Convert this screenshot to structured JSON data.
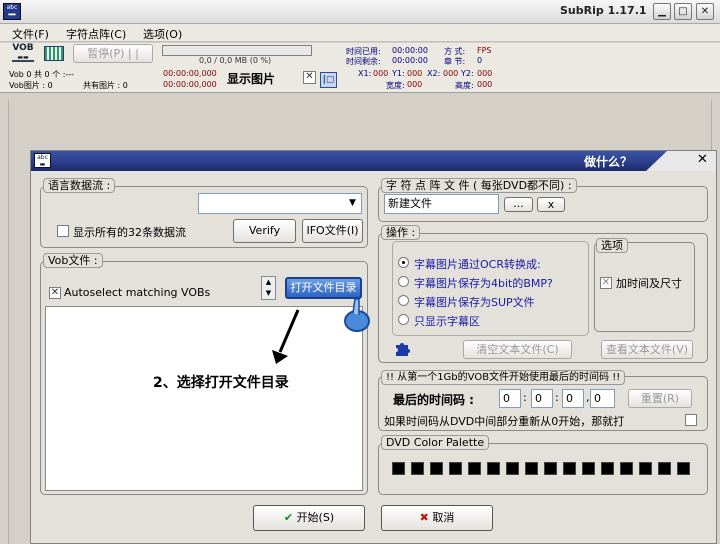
{
  "window": {
    "title": "SubRip 1.17.1",
    "icon": "abc"
  },
  "menu": [
    "文件(F)",
    "字符点阵(C)",
    "选项(O)"
  ],
  "toolbar": {
    "vob_label": "VOB",
    "pause_label": "暂停(P) | |",
    "progress_text": "0,0 / 0,0 MB (0 %)",
    "elapsed_label": "时间已用:",
    "elapsed_value": "00:00:00",
    "remaining_label": "时间剩余:",
    "remaining_value": "00:00:00",
    "mode_label": "方 式:",
    "mode_value": "FPS",
    "chapter_label": "章 节:",
    "chapter_value": "0",
    "vob_status": "Vob 0  共 0 个 :---",
    "vob_pictures": "Vob图片 : 0",
    "total_pictures": "共有图片 : 0",
    "time1": "00:00:00,000",
    "time2": "00:00:00,000",
    "show_picture": "显示图片",
    "x1_label": "X1:",
    "x1_value": "000",
    "y1_label": "Y1:",
    "y1_value": "000",
    "x2_label": "X2:",
    "x2_value": "000",
    "y2_label": "Y2:",
    "y2_value": "000",
    "width_label": "宽度:",
    "width_value": "000",
    "height_label": "高度:",
    "height_value": "000"
  },
  "dialog": {
    "title": "做什么？",
    "language": {
      "group_label": "语言数据流 :",
      "show_all": "显示所有的32条数据流",
      "verify": "Verify",
      "ifo": "IFO文件(I)"
    },
    "vob": {
      "group_label": "Vob文件 :",
      "autoselect": "Autoselect matching VOBs",
      "open_dir": "打开文件目录",
      "annotation": "2、选择打开文件目录"
    },
    "charmap": {
      "group_label": "字 符 点 阵 文 件      ( 每张DVD都不同) :",
      "value": "新建文件",
      "browse": "...",
      "clear": "x"
    },
    "ops": {
      "group_label": "操作 :",
      "options": [
        "字幕图片通过OCR转换成:",
        "字幕图片保存为4bit的BMP?",
        "字幕图片保存为SUP文件",
        "只显示字幕区"
      ],
      "selected": 0,
      "clear_text": "清空文本文件(C)",
      "view_text": "查看文本文件(V)"
    },
    "options": {
      "group_label": "选项",
      "add_time": "加时间及尺寸"
    },
    "timecode": {
      "group_label": "!! 从第一个1Gb的VOB文件开始使用最后的时间码 !!",
      "last_label": "最后的时间码 :",
      "fields": [
        "0",
        "0",
        "0",
        "0"
      ],
      "reset": "重置(R)",
      "restart_text": "如果时间码从DVD中间部分重新从0开始，那就打"
    },
    "palette": {
      "group_label": "DVD Color Palette",
      "count": 16
    },
    "start": "开始(S)",
    "cancel": "取消"
  }
}
